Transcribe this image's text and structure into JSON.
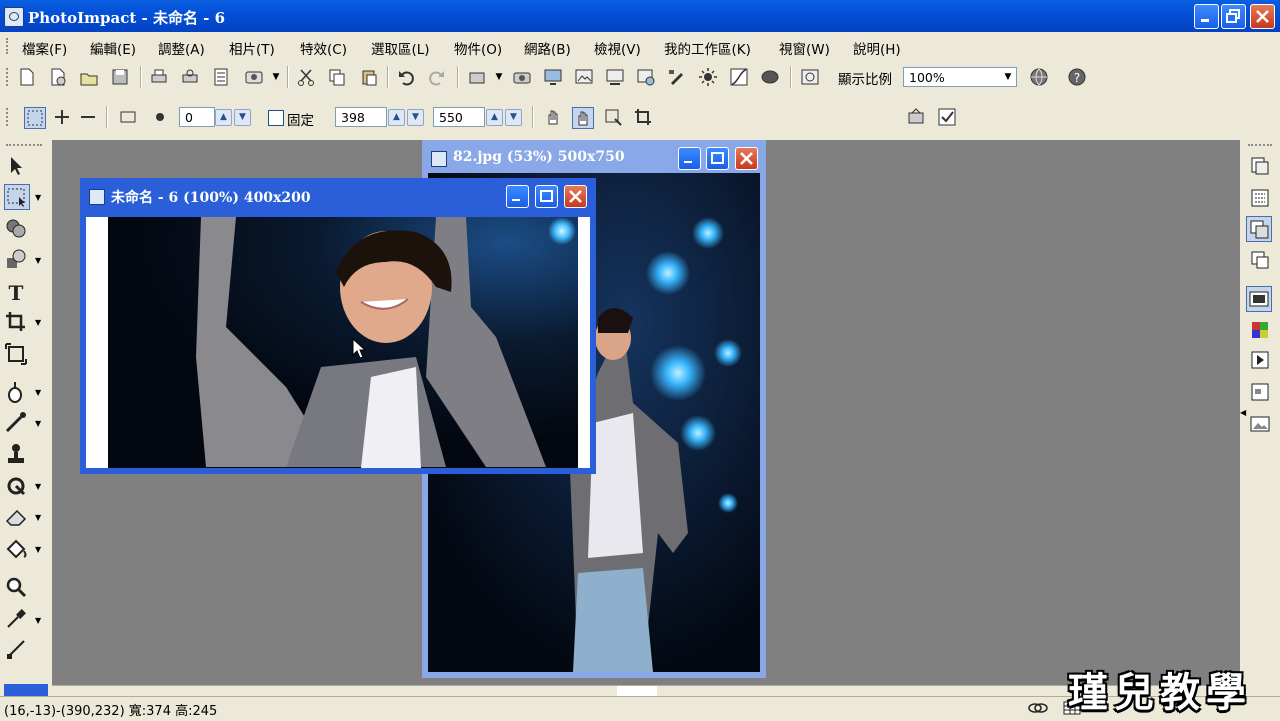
{
  "window": {
    "title": "PhotoImpact - 未命名 - 6"
  },
  "menu": [
    "檔案(F)",
    "編輯(E)",
    "調整(A)",
    "相片(T)",
    "特效(C)",
    "選取區(L)",
    "物件(O)",
    "網路(B)",
    "檢視(V)",
    "我的工作區(K)",
    "視窗(W)",
    "說明(H)"
  ],
  "toolbar": {
    "zoom_label": "顯示比例",
    "zoom_value": "100%"
  },
  "options": {
    "value0": "0",
    "fixed_label": "固定",
    "width": "398",
    "height": "550"
  },
  "docs": {
    "back_title": "82.jpg (53%) 500x750",
    "front_title": "未命名 - 6 (100%) 400x200"
  },
  "status": {
    "text": "(16,-13)-(390,232) 寬:374 高:245"
  },
  "watermark": "瑾兒教學",
  "colors": {
    "titlebar": "#0450d8",
    "workspace": "#808080",
    "chrome": "#ece9d8"
  }
}
